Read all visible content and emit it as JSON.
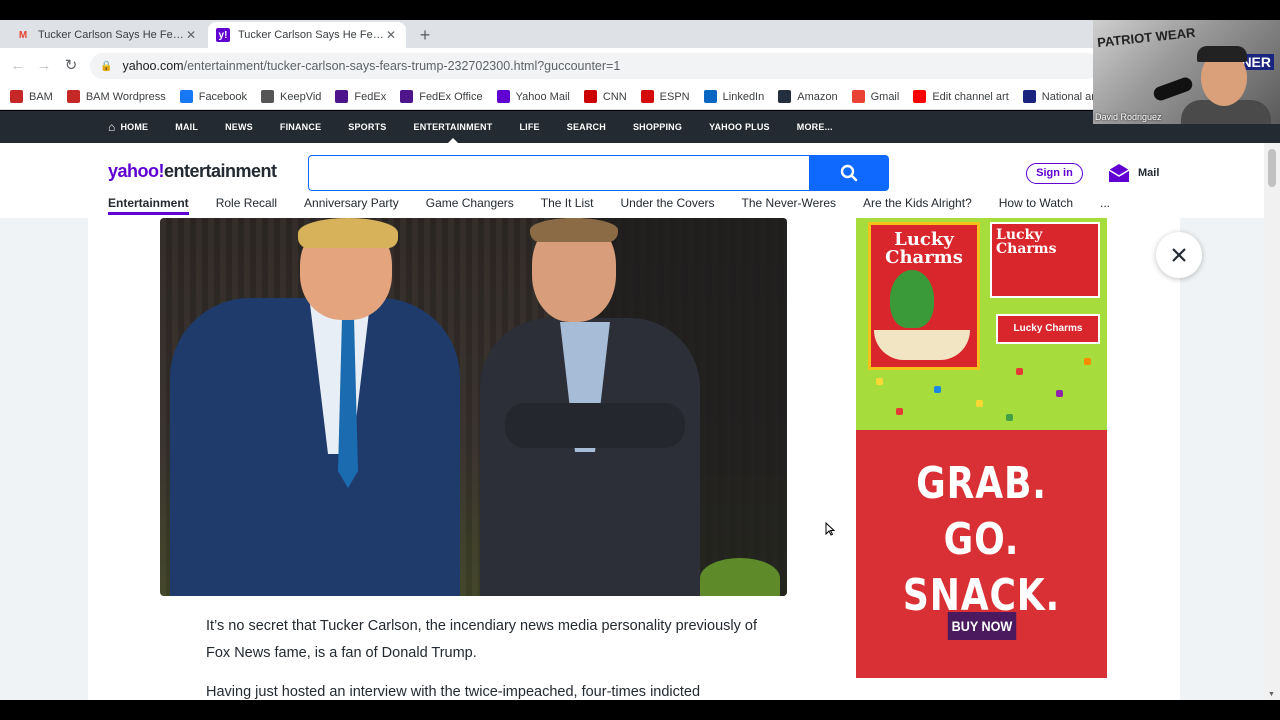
{
  "browser": {
    "tabs": [
      {
        "title": "Tucker Carlson Says He Fears for",
        "favicon": "gmail-icon",
        "active": false
      },
      {
        "title": "Tucker Carlson Says He Fears for",
        "favicon": "yahoo-icon",
        "active": true
      }
    ],
    "new_tab_symbol": "+",
    "url_host": "yahoo.com",
    "url_path": "/entertainment/tucker-carlson-says-fears-trump-232702300.html?guccounter=1",
    "bookmarks": [
      {
        "label": "BAM",
        "icon": "bam-icon",
        "color": "#c62828"
      },
      {
        "label": "BAM Wordpress",
        "icon": "bam-icon",
        "color": "#c62828"
      },
      {
        "label": "Facebook",
        "icon": "facebook-icon",
        "color": "#1877f2"
      },
      {
        "label": "KeepVid",
        "icon": "keepvid-icon",
        "color": "#555555"
      },
      {
        "label": "FedEx",
        "icon": "fedex-icon",
        "color": "#4d148c"
      },
      {
        "label": "FedEx Office",
        "icon": "fedex-icon",
        "color": "#4d148c"
      },
      {
        "label": "Yahoo Mail",
        "icon": "yahoo-icon",
        "color": "#6001d2"
      },
      {
        "label": "CNN",
        "icon": "cnn-icon",
        "color": "#cc0000"
      },
      {
        "label": "ESPN",
        "icon": "espn-icon",
        "color": "#d50a0a"
      },
      {
        "label": "LinkedIn",
        "icon": "linkedin-icon",
        "color": "#0a66c2"
      },
      {
        "label": "Amazon",
        "icon": "amazon-icon",
        "color": "#232f3e"
      },
      {
        "label": "Gmail",
        "icon": "gmail-icon",
        "color": "#ea4335"
      },
      {
        "label": "Edit channel art",
        "icon": "youtube-icon",
        "color": "#ff0000"
      },
      {
        "label": "National and Local...",
        "icon": "news-icon",
        "color": "#1a237e"
      }
    ]
  },
  "webcam": {
    "name": "David Rodriguez",
    "sign_left": "PATRIOT WEAR",
    "sign_right": "CORNER"
  },
  "yahoo_nav": {
    "items": [
      "HOME",
      "MAIL",
      "NEWS",
      "FINANCE",
      "SPORTS",
      "ENTERTAINMENT",
      "LIFE",
      "SEARCH",
      "SHOPPING",
      "YAHOO PLUS",
      "MORE..."
    ],
    "active": "ENTERTAINMENT"
  },
  "header": {
    "logo_brand": "yahoo!",
    "logo_section": "entertainment",
    "search_placeholder": "",
    "signin_label": "Sign in",
    "mail_label": "Mail",
    "brand_color": "#6001d2",
    "search_color": "#0f69ff"
  },
  "subnav": {
    "items": [
      "Entertainment",
      "Role Recall",
      "Anniversary Party",
      "Game Changers",
      "The It List",
      "Under the Covers",
      "The Never-Weres",
      "Are the Kids Alright?",
      "How to Watch",
      "..."
    ],
    "active": "Entertainment"
  },
  "article": {
    "paragraph_1": "It’s no secret that Tucker Carlson, the incendiary news media personality previously of Fox News fame, is a fan of Donald Trump.",
    "paragraph_2": "Having just hosted an interview with the twice-impeached, four-times indicted"
  },
  "ad": {
    "brand_box": "Lucky Charms",
    "brand_box_small": "Lucky Charms",
    "bar_label": "Lucky Charms",
    "headline_line1": "GRAB. GO.",
    "headline_line2": "SNACK.",
    "cta_label": "BUY NOW"
  }
}
